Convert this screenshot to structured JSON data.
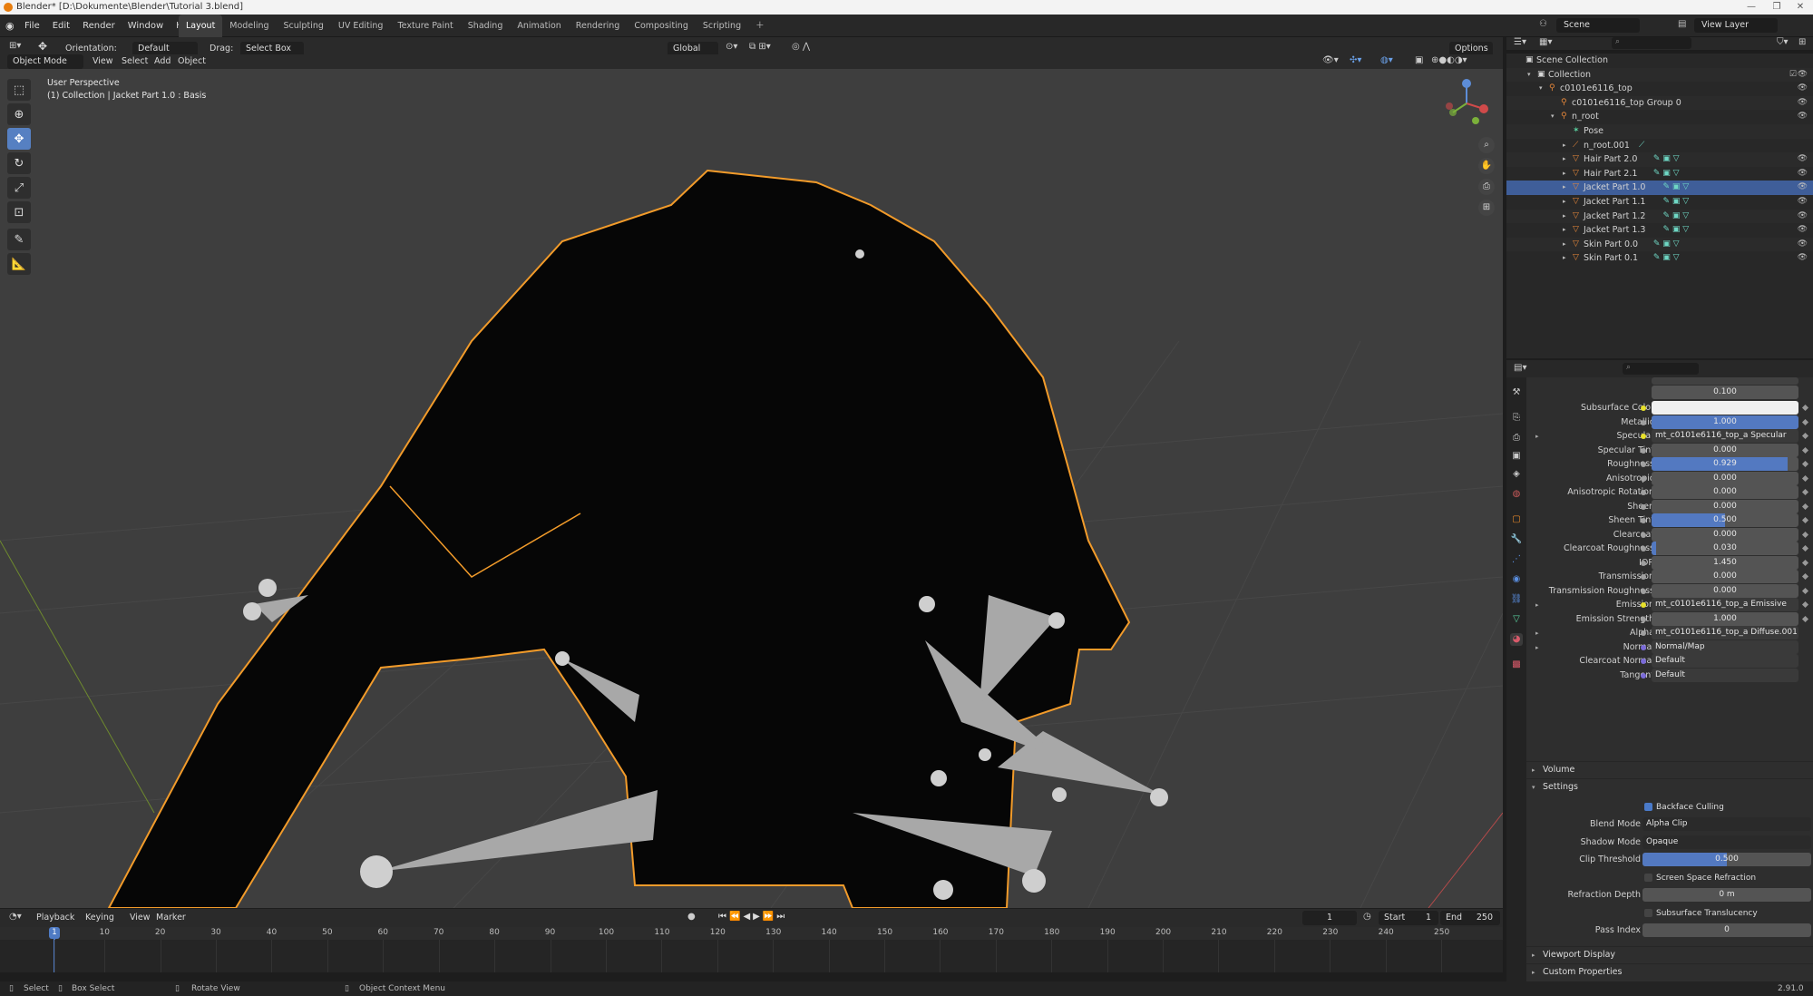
{
  "window": {
    "title": "Blender* [D:\\Dokumente\\Blender\\Tutorial 3.blend]"
  },
  "menu": [
    "File",
    "Edit",
    "Render",
    "Window",
    "Help"
  ],
  "workspaces": [
    {
      "label": "Layout",
      "active": true
    },
    {
      "label": "Modeling"
    },
    {
      "label": "Sculpting"
    },
    {
      "label": "UV Editing"
    },
    {
      "label": "Texture Paint"
    },
    {
      "label": "Shading"
    },
    {
      "label": "Animation"
    },
    {
      "label": "Rendering"
    },
    {
      "label": "Compositing"
    },
    {
      "label": "Scripting"
    }
  ],
  "topbar": {
    "scene_label": "Scene",
    "view_layer_label": "View Layer"
  },
  "tool_settings": {
    "orientation_label": "Orientation:",
    "orientation_value": "Default",
    "drag_label": "Drag:",
    "drag_value": "Select Box",
    "transform_orientation": "Global",
    "options_label": "Options"
  },
  "viewport_header": {
    "mode": "Object Mode",
    "menus": [
      "View",
      "Select",
      "Add",
      "Object"
    ]
  },
  "viewport": {
    "perspective_text": "User Perspective",
    "context_text": "(1) Collection | Jacket Part 1.0 : Basis"
  },
  "timeline": {
    "menus": [
      "Playback",
      "Keying",
      "View",
      "Marker"
    ],
    "current_frame": "1",
    "start_label": "Start",
    "start": "1",
    "end_label": "End",
    "end": "250",
    "ticks": [
      "1",
      "10",
      "20",
      "30",
      "40",
      "50",
      "60",
      "70",
      "80",
      "90",
      "100",
      "110",
      "120",
      "130",
      "140",
      "150",
      "160",
      "170",
      "180",
      "190",
      "200",
      "210",
      "220",
      "230",
      "240",
      "250"
    ],
    "playhead": "1"
  },
  "statusbar": {
    "select": "Select",
    "box_select": "Box Select",
    "rotate": "Rotate View",
    "context_menu": "Object Context Menu",
    "version": "2.91.0"
  },
  "outliner": {
    "rows": [
      {
        "label": "Scene Collection",
        "indent": 0,
        "icon": "collection-icon",
        "eye": false,
        "tri": ""
      },
      {
        "label": "Collection",
        "indent": 1,
        "icon": "collection-icon",
        "eye": true,
        "tri": "▾",
        "check": true
      },
      {
        "label": "c0101e6116_top",
        "indent": 2,
        "icon": "armature-icon",
        "eye": true,
        "tri": "▾"
      },
      {
        "label": "c0101e6116_top Group 0",
        "indent": 3,
        "icon": "armature-icon",
        "eye": true,
        "tri": ""
      },
      {
        "label": "n_root",
        "indent": 3,
        "icon": "armature-icon",
        "eye": true,
        "tri": "▾"
      },
      {
        "label": "Pose",
        "indent": 4,
        "icon": "pose-icon",
        "eye": false,
        "tri": ""
      },
      {
        "label": "n_root.001",
        "indent": 4,
        "icon": "bone-icon",
        "eye": false,
        "tri": "▸",
        "extras": "⟋"
      },
      {
        "label": "Hair Part 2.0",
        "indent": 4,
        "icon": "mesh-icon",
        "eye": true,
        "tri": "▸",
        "extras": "✎ ▣ ▽"
      },
      {
        "label": "Hair Part 2.1",
        "indent": 4,
        "icon": "mesh-icon",
        "eye": true,
        "tri": "▸",
        "extras": "✎ ▣ ▽"
      },
      {
        "label": "Jacket Part 1.0",
        "indent": 4,
        "icon": "mesh-icon",
        "eye": true,
        "tri": "▸",
        "extras": "✎ ▣ ▽",
        "selected": true
      },
      {
        "label": "Jacket Part 1.1",
        "indent": 4,
        "icon": "mesh-icon",
        "eye": true,
        "tri": "▸",
        "extras": "✎ ▣ ▽"
      },
      {
        "label": "Jacket Part 1.2",
        "indent": 4,
        "icon": "mesh-icon",
        "eye": true,
        "tri": "▸",
        "extras": "✎ ▣ ▽"
      },
      {
        "label": "Jacket Part 1.3",
        "indent": 4,
        "icon": "mesh-icon",
        "eye": true,
        "tri": "▸",
        "extras": "✎ ▣ ▽"
      },
      {
        "label": "Skin Part 0.0",
        "indent": 4,
        "icon": "mesh-icon",
        "eye": true,
        "tri": "▸",
        "extras": "✎ ▣ ▽"
      },
      {
        "label": "Skin Part 0.1",
        "indent": 4,
        "icon": "mesh-icon",
        "eye": true,
        "tri": "▸",
        "extras": "✎ ▣ ▽"
      }
    ]
  },
  "properties": {
    "top_partial": "0.100",
    "rows": [
      {
        "label": "Subsurface Color",
        "type": "color",
        "dot": "y",
        "value": ""
      },
      {
        "label": "Metallic",
        "type": "slider",
        "dot": "g",
        "value": "1.000",
        "fill": 1.0
      },
      {
        "label": "Specular",
        "type": "link",
        "dot": "y",
        "value": "mt_c0101e6116_top_a Specular",
        "expand": true
      },
      {
        "label": "Specular Tint",
        "type": "slider",
        "dot": "g",
        "value": "0.000",
        "fill": 0
      },
      {
        "label": "Roughness",
        "type": "slider",
        "dot": "g",
        "value": "0.929",
        "fill": 0.929
      },
      {
        "label": "Anisotropic",
        "type": "slider",
        "dot": "g",
        "value": "0.000",
        "fill": 0
      },
      {
        "label": "Anisotropic Rotation",
        "type": "slider",
        "dot": "g",
        "value": "0.000",
        "fill": 0
      },
      {
        "label": "Sheen",
        "type": "slider",
        "dot": "g",
        "value": "0.000",
        "fill": 0
      },
      {
        "label": "Sheen Tint",
        "type": "slider",
        "dot": "g",
        "value": "0.500",
        "fill": 0.5
      },
      {
        "label": "Clearcoat",
        "type": "slider",
        "dot": "g",
        "value": "0.000",
        "fill": 0
      },
      {
        "label": "Clearcoat Roughness",
        "type": "slider",
        "dot": "g",
        "value": "0.030",
        "fill": 0.03
      },
      {
        "label": "IOR",
        "type": "slider",
        "dot": "g",
        "value": "1.450",
        "fill": 0
      },
      {
        "label": "Transmission",
        "type": "slider",
        "dot": "g",
        "value": "0.000",
        "fill": 0
      },
      {
        "label": "Transmission Roughness",
        "type": "slider",
        "dot": "g",
        "value": "0.000",
        "fill": 0
      },
      {
        "label": "Emission",
        "type": "link",
        "dot": "y",
        "value": "mt_c0101e6116_top_a Emissive",
        "expand": true
      },
      {
        "label": "Emission Strength",
        "type": "slider",
        "dot": "g",
        "value": "1.000",
        "fill": 0
      },
      {
        "label": "Alpha",
        "type": "link",
        "dot": "g",
        "value": "mt_c0101e6116_top_a Diffuse.001",
        "expand": true
      },
      {
        "label": "Normal",
        "type": "link",
        "dot": "p",
        "value": "Normal/Map",
        "expand": true
      },
      {
        "label": "Clearcoat Normal",
        "type": "link",
        "dot": "p",
        "value": "Default"
      },
      {
        "label": "Tangent",
        "type": "link",
        "dot": "p",
        "value": "Default"
      }
    ],
    "sections": {
      "volume": "Volume",
      "settings": "Settings",
      "viewport_display": "Viewport Display",
      "custom_properties": "Custom Properties"
    },
    "settings": {
      "backface_culling": "Backface Culling",
      "blend_mode_label": "Blend Mode",
      "blend_mode": "Alpha Clip",
      "shadow_mode_label": "Shadow Mode",
      "shadow_mode": "Opaque",
      "clip_threshold_label": "Clip Threshold",
      "clip_threshold": "0.500",
      "clip_fill": 0.5,
      "screen_space_refraction": "Screen Space Refraction",
      "refraction_depth_label": "Refraction Depth",
      "refraction_depth": "0 m",
      "subsurface_translucency": "Subsurface Translucency",
      "pass_index_label": "Pass Index",
      "pass_index": "0"
    }
  },
  "colors": {
    "accent": "#5680c2",
    "selection_outline": "#f29b2a",
    "selected_row": "#3f5e99"
  }
}
